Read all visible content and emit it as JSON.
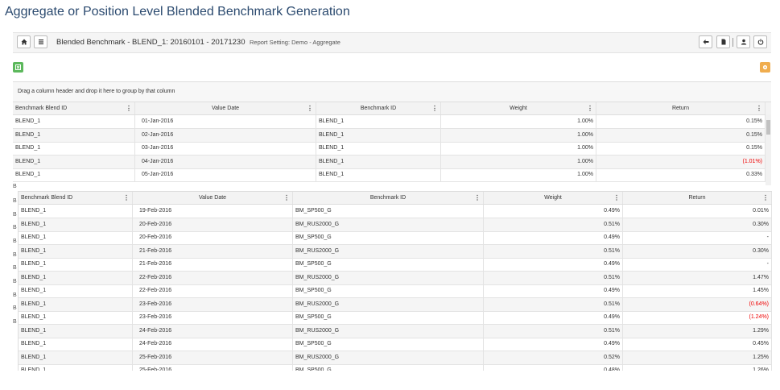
{
  "page": {
    "title": "Aggregate or Position Level Blended Benchmark Generation"
  },
  "toolbar": {
    "title": "Blended Benchmark - BLEND_1: 20160101 - 20171230",
    "report_setting": "Report Setting: Demo - Aggregate",
    "left_icons": [
      "home-icon",
      "menu-icon"
    ],
    "right_icons": [
      "back-arrow-icon",
      "document-icon",
      "user-icon",
      "power-icon"
    ]
  },
  "actions": {
    "excel_icon": "excel-export-icon",
    "settings_icon": "settings-icon",
    "green": "#5cb85c",
    "orange": "#f0ad4e"
  },
  "group_panel": {
    "text": "Drag a column header and drop it here to group by that column"
  },
  "grid_main": {
    "columns": [
      "Benchmark Blend ID",
      "Value Date",
      "Benchmark ID",
      "Weight",
      "Return"
    ],
    "rows": [
      [
        "BLEND_1",
        "01-Jan-2016",
        "BLEND_1",
        "1.00%",
        "0.15%"
      ],
      [
        "BLEND_1",
        "02-Jan-2016",
        "BLEND_1",
        "1.00%",
        "0.15%"
      ],
      [
        "BLEND_1",
        "03-Jan-2016",
        "BLEND_1",
        "1.00%",
        "0.15%"
      ],
      [
        "BLEND_1",
        "04-Jan-2016",
        "BLEND_1",
        "1.00%",
        "(1.01%)"
      ],
      [
        "BLEND_1",
        "05-Jan-2016",
        "BLEND_1",
        "1.00%",
        "0.33%"
      ]
    ]
  },
  "grid_detail": {
    "columns": [
      "Benchmark Blend ID",
      "Value Date",
      "Benchmark ID",
      "Weight",
      "Return"
    ],
    "rows": [
      [
        "BLEND_1",
        "19-Feb-2016",
        "BM_SP500_G",
        "0.49%",
        "0.01%"
      ],
      [
        "BLEND_1",
        "20-Feb-2016",
        "BM_RUS2000_G",
        "0.51%",
        "0.30%"
      ],
      [
        "BLEND_1",
        "20-Feb-2016",
        "BM_SP500_G",
        "0.49%",
        "-"
      ],
      [
        "BLEND_1",
        "21-Feb-2016",
        "BM_RUS2000_G",
        "0.51%",
        "0.30%"
      ],
      [
        "BLEND_1",
        "21-Feb-2016",
        "BM_SP500_G",
        "0.49%",
        "-"
      ],
      [
        "BLEND_1",
        "22-Feb-2016",
        "BM_RUS2000_G",
        "0.51%",
        "1.47%"
      ],
      [
        "BLEND_1",
        "22-Feb-2016",
        "BM_SP500_G",
        "0.49%",
        "1.45%"
      ],
      [
        "BLEND_1",
        "23-Feb-2016",
        "BM_RUS2000_G",
        "0.51%",
        "(0.64%)"
      ],
      [
        "BLEND_1",
        "23-Feb-2016",
        "BM_SP500_G",
        "0.49%",
        "(1.24%)"
      ],
      [
        "BLEND_1",
        "24-Feb-2016",
        "BM_RUS2000_G",
        "0.51%",
        "1.29%"
      ],
      [
        "BLEND_1",
        "24-Feb-2016",
        "BM_SP500_G",
        "0.49%",
        "0.45%"
      ],
      [
        "BLEND_1",
        "25-Feb-2016",
        "BM_RUS2000_G",
        "0.52%",
        "1.25%"
      ],
      [
        "BLEND_1",
        "25-Feb-2016",
        "BM_SP500_G",
        "0.48%",
        "1.26%"
      ]
    ]
  },
  "ghost_prefix": "B"
}
